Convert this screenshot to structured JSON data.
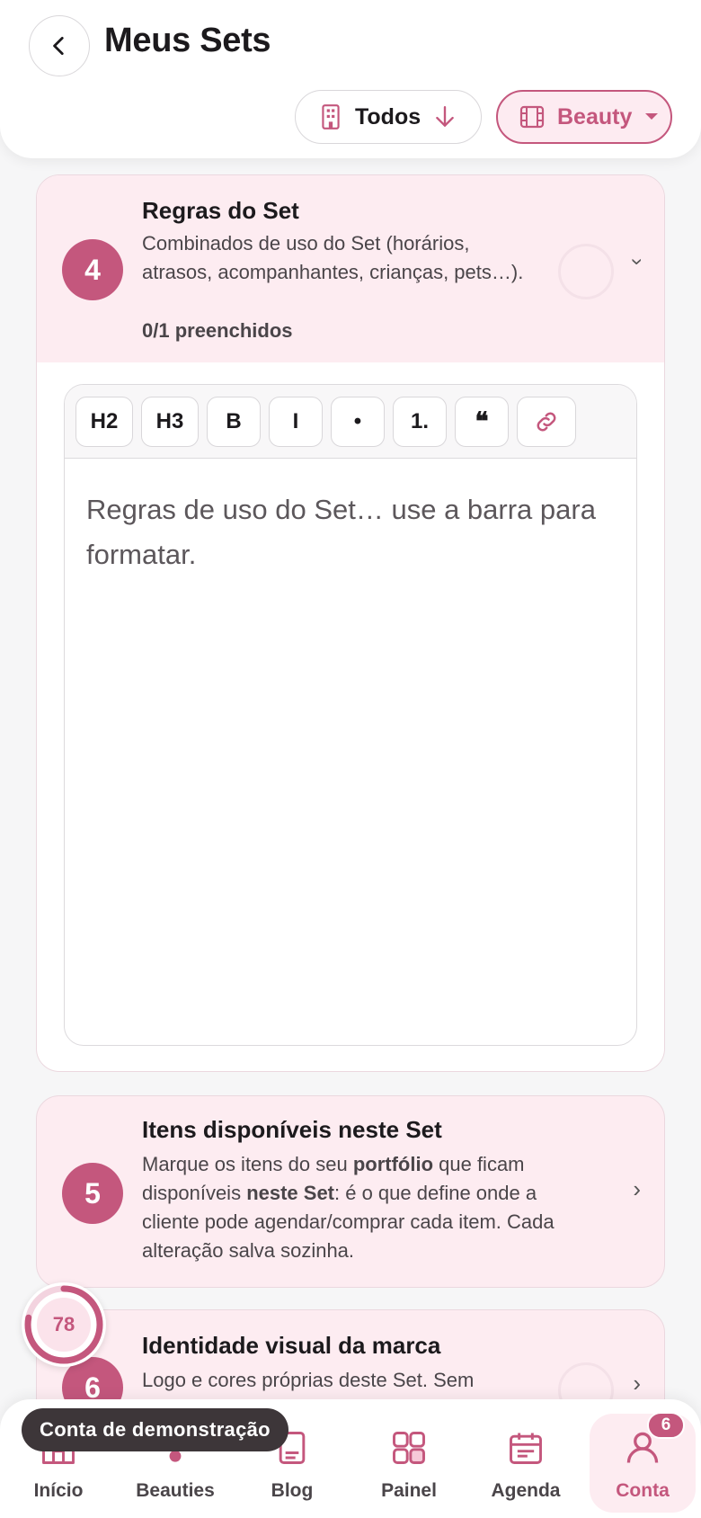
{
  "header": {
    "title": "Meus Sets",
    "filter_todos": "Todos",
    "filter_beauty": "Beauty"
  },
  "card4": {
    "step": "4",
    "title": "Regras do Set",
    "description": "Combinados de uso do Set (horários, atrasos, acompanhantes, crianças, pets…).",
    "progress": "0/1 preenchidos"
  },
  "editor": {
    "toolbar": [
      "H2",
      "H3",
      "B",
      "I",
      "•",
      "1.",
      "❝"
    ],
    "placeholder": "Regras de uso do Set… use a barra para formatar."
  },
  "card5": {
    "step": "5",
    "title": "Itens disponíveis neste Set",
    "desc_1": "Marque os itens do seu ",
    "desc_bold_1": "portfólio",
    "desc_2": " que ficam disponíveis ",
    "desc_bold_2": "neste Set",
    "desc_3": ": é o que define onde a cliente pode agendar/comprar cada item. Cada alteração salva sozinha."
  },
  "card6": {
    "step": "6",
    "title": "Identidade visual da marca",
    "description": "Logo e cores próprias deste Set. Sem"
  },
  "progress_bubble": {
    "value": "78",
    "fraction": 0.78
  },
  "toast": "Conta de demonstração",
  "nav": {
    "items": [
      {
        "label": "Início",
        "icon": "home-icon"
      },
      {
        "label": "Beauties",
        "icon": "beauties-icon"
      },
      {
        "label": "Blog",
        "icon": "blog-icon"
      },
      {
        "label": "Painel",
        "icon": "grid-icon"
      },
      {
        "label": "Agenda",
        "icon": "calendar-icon"
      },
      {
        "label": "Conta",
        "icon": "user-icon"
      }
    ],
    "badge": "6"
  },
  "colors": {
    "accent": "#c4577d",
    "accent_bg": "#fdecf1"
  }
}
